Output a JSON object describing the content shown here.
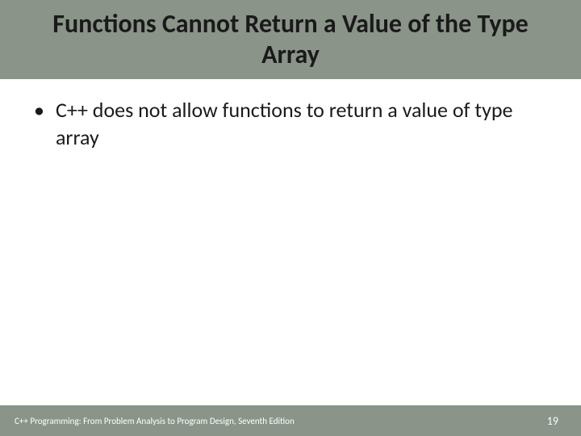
{
  "header": {
    "title": "Functions Cannot Return a Value of the Type Array"
  },
  "content": {
    "bullets": [
      "C++ does not allow functions to return a value of type array"
    ]
  },
  "footer": {
    "text": "C++ Programming: From Problem Analysis to Program Design, Seventh Edition",
    "page_number": "19"
  }
}
